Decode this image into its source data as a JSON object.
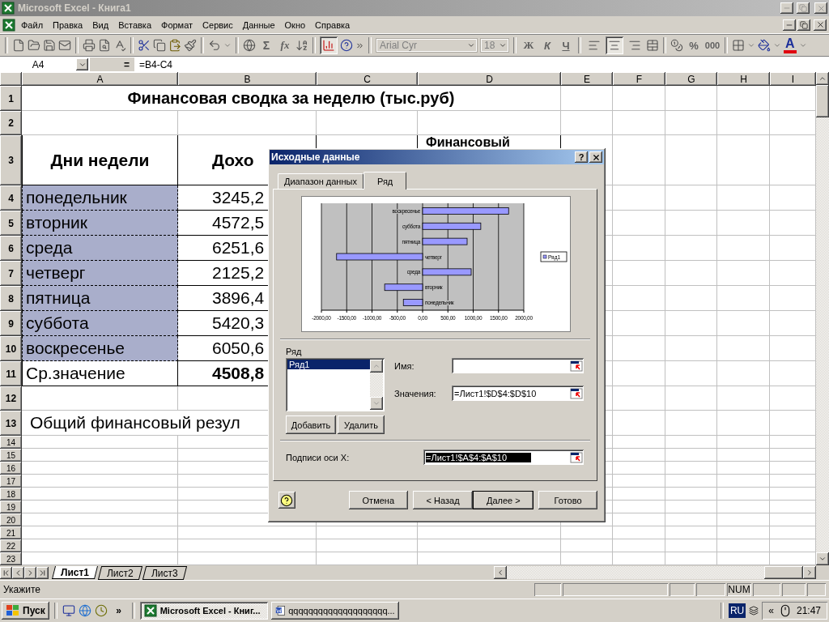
{
  "window": {
    "title": "Microsoft Excel - Книга1"
  },
  "menu": [
    {
      "label": "Файл"
    },
    {
      "label": "Правка"
    },
    {
      "label": "Вид"
    },
    {
      "label": "Вставка"
    },
    {
      "label": "Формат"
    },
    {
      "label": "Сервис"
    },
    {
      "label": "Данные"
    },
    {
      "label": "Окно"
    },
    {
      "label": "Справка"
    }
  ],
  "toolbar": {
    "sum": "Σ",
    "function": "fx",
    "chart_wizard": {
      "pressed": true
    },
    "font_box": {
      "value": "Arial Cyr",
      "disabled": true
    },
    "size_box": {
      "value": "18",
      "disabled": true
    },
    "bold": "Ж",
    "italic": "К",
    "underline": "Ч",
    "align": [
      {
        "selected": false
      },
      {
        "selected": true
      },
      {
        "selected": false
      }
    ],
    "percent": "%",
    "thousands": "000",
    "font_color": "A"
  },
  "formula_bar": {
    "name_box": "A4",
    "equals": "=",
    "formula": "=B4-C4"
  },
  "columns": [
    "A",
    "B",
    "C",
    "D",
    "E",
    "F",
    "G",
    "H",
    "I"
  ],
  "rows": [
    {
      "number": "1",
      "kind": "title",
      "cells": {
        "A": "Финансовая сводка за неделю (тыс.руб)"
      }
    },
    {
      "number": "2",
      "kind": "blank"
    },
    {
      "number": "3",
      "kind": "header",
      "cells": {
        "A": "Дни недели",
        "B": "Дохо",
        "D": "Финансовый"
      }
    },
    {
      "number": "4",
      "kind": "data",
      "highlighted": true,
      "cells": {
        "A": "понедельник",
        "B": "3245,2"
      }
    },
    {
      "number": "5",
      "kind": "data",
      "highlighted": true,
      "cells": {
        "A": "вторник",
        "B": "4572,5"
      }
    },
    {
      "number": "6",
      "kind": "data",
      "highlighted": true,
      "cells": {
        "A": "среда",
        "B": "6251,6"
      }
    },
    {
      "number": "7",
      "kind": "data",
      "highlighted": true,
      "cells": {
        "A": "четверг",
        "B": "2125,2"
      }
    },
    {
      "number": "8",
      "kind": "data",
      "highlighted": true,
      "cells": {
        "A": "пятница",
        "B": "3896,4"
      }
    },
    {
      "number": "9",
      "kind": "data",
      "highlighted": true,
      "cells": {
        "A": "суббота",
        "B": "5420,3"
      }
    },
    {
      "number": "10",
      "kind": "data",
      "highlighted": true,
      "cells": {
        "A": "воскресенье",
        "B": "6050,6"
      }
    },
    {
      "number": "11",
      "kind": "total",
      "cells": {
        "A": "Ср.значение",
        "B": "4508,8"
      }
    },
    {
      "number": "12",
      "kind": "blank"
    },
    {
      "number": "13",
      "kind": "note",
      "cells": {
        "A": "Общий финансовый резул"
      }
    },
    {
      "number": "14",
      "kind": "small"
    },
    {
      "number": "15",
      "kind": "small"
    },
    {
      "number": "16",
      "kind": "small"
    },
    {
      "number": "17",
      "kind": "small"
    },
    {
      "number": "18",
      "kind": "small"
    },
    {
      "number": "19",
      "kind": "small"
    },
    {
      "number": "20",
      "kind": "small"
    },
    {
      "number": "21",
      "kind": "small"
    },
    {
      "number": "22",
      "kind": "small"
    },
    {
      "number": "23",
      "kind": "small"
    }
  ],
  "dialog": {
    "title": "Исходные данные",
    "help": "?",
    "tabs": [
      {
        "label": "Диапазон данных",
        "selected": false
      },
      {
        "label": "Ряд",
        "selected": true
      }
    ],
    "chart_data": {
      "type": "bar",
      "orientation": "horizontal",
      "grid": true,
      "categories": [
        "воскресенье",
        "суббота",
        "пятница",
        "четверг",
        "среда",
        "вторник",
        "понедельник"
      ],
      "series": [
        {
          "name": "Ряд1",
          "color": "#9999ff",
          "values": [
            1700,
            1150,
            880,
            -1700,
            960,
            -750,
            -380
          ]
        }
      ],
      "xlim": [
        -2000,
        2000
      ],
      "xticks": [
        {
          "value": -2000,
          "label": "-2000,00"
        },
        {
          "value": -1500,
          "label": "-1500,00"
        },
        {
          "value": -1000,
          "label": "-1000,00"
        },
        {
          "value": -500,
          "label": "-500,00"
        },
        {
          "value": 0,
          "label": "0,00"
        },
        {
          "value": 500,
          "label": "500,00"
        },
        {
          "value": 1000,
          "label": "1000,00"
        },
        {
          "value": 1500,
          "label": "1500,00"
        },
        {
          "value": 2000,
          "label": "2000,00"
        }
      ]
    },
    "series_label": "Ряд",
    "series_list": [
      {
        "label": "Ряд1",
        "selected": true
      }
    ],
    "series_buttons": [
      "Добавить",
      "Удалить"
    ],
    "fields": [
      {
        "label": "Имя:"
      },
      {
        "label": "Значения:",
        "value": "=Лист1!$D$4:$D$10"
      }
    ],
    "axis_field": {
      "label": "Подписи оси X:",
      "value": "=Лист1!$A$4:$A$10",
      "selected": true
    },
    "buttons": [
      {
        "label": "Отмена",
        "default": false
      },
      {
        "label": "< Назад",
        "default": false
      },
      {
        "label": "Далее >",
        "default": true
      },
      {
        "label": "Готово",
        "default": false
      }
    ]
  },
  "sheet_tabs": [
    {
      "label": "Лист1",
      "selected": true
    },
    {
      "label": "Лист2",
      "selected": false
    },
    {
      "label": "Лист3",
      "selected": false
    }
  ],
  "status_bar": {
    "text": "Укажите",
    "num_lock": "NUM"
  },
  "taskbar": {
    "start": "Пуск",
    "more": "»",
    "tasks": [
      {
        "label": "Microsoft Excel - Книг...",
        "selected": true,
        "kind": "spreadsheet"
      },
      {
        "label": "qqqqqqqqqqqqqqqqqqqq...",
        "selected": false,
        "kind": "document"
      }
    ],
    "language": "RU",
    "tray_more": "«",
    "clock": "21:47"
  }
}
